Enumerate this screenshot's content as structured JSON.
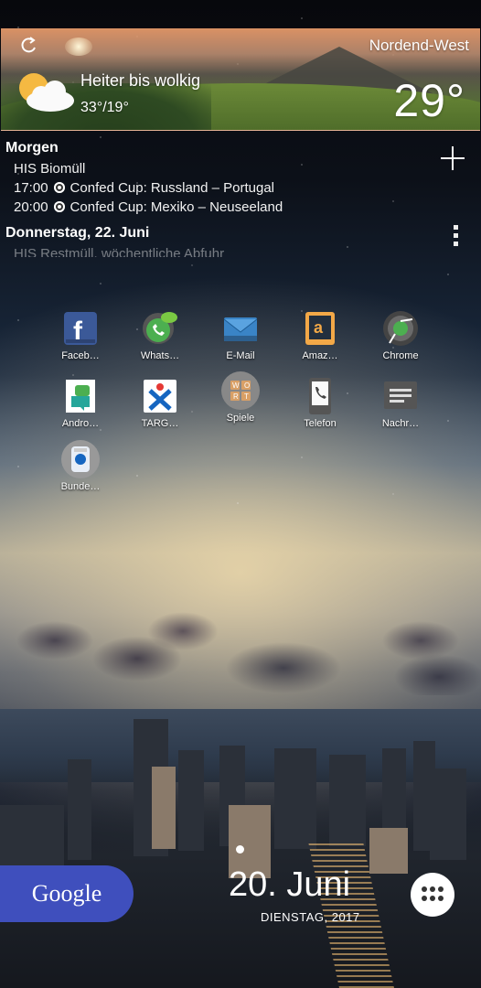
{
  "weather": {
    "location": "Nordend-West",
    "condition": "Heiter bis wolkig",
    "high_low": "33°/19°",
    "temperature": "29°"
  },
  "agenda": {
    "day1": {
      "title": "Morgen",
      "events": [
        "HIS Biomüll",
        "17:00",
        "Confed Cup: Russland – Portugal",
        "20:00",
        "Confed Cup: Mexiko – Neuseeland"
      ]
    },
    "day2": {
      "title": "Donnerstag, 22. Juni",
      "event": "HIS Restmüll, wöchentliche Abfuhr"
    }
  },
  "apps": [
    {
      "label": "Faceb…",
      "icon": "facebook-icon"
    },
    {
      "label": "Whats…",
      "icon": "whatsapp-icon"
    },
    {
      "label": "E-Mail",
      "icon": "email-icon"
    },
    {
      "label": "Amaz…",
      "icon": "amazon-icon"
    },
    {
      "label": "Chrome",
      "icon": "chrome-icon"
    },
    {
      "label": "Andro…",
      "icon": "android-icon"
    },
    {
      "label": "TARG…",
      "icon": "target-icon"
    },
    {
      "label": "Spiele",
      "icon": "games-icon"
    },
    {
      "label": "Telefon",
      "icon": "phone-icon"
    },
    {
      "label": "Nachr…",
      "icon": "messages-icon"
    },
    {
      "label": "Bunde…",
      "icon": "bundesliga-icon"
    }
  ],
  "dock": {
    "search_label": "Google",
    "date": "20. Juni",
    "weekday": "DIENSTAG, 2017"
  },
  "colors": {
    "google_bar": "#3f4fbd",
    "facebook": "#3b5998",
    "whatsapp": "#4caf50",
    "amazon": "#f3a847"
  }
}
